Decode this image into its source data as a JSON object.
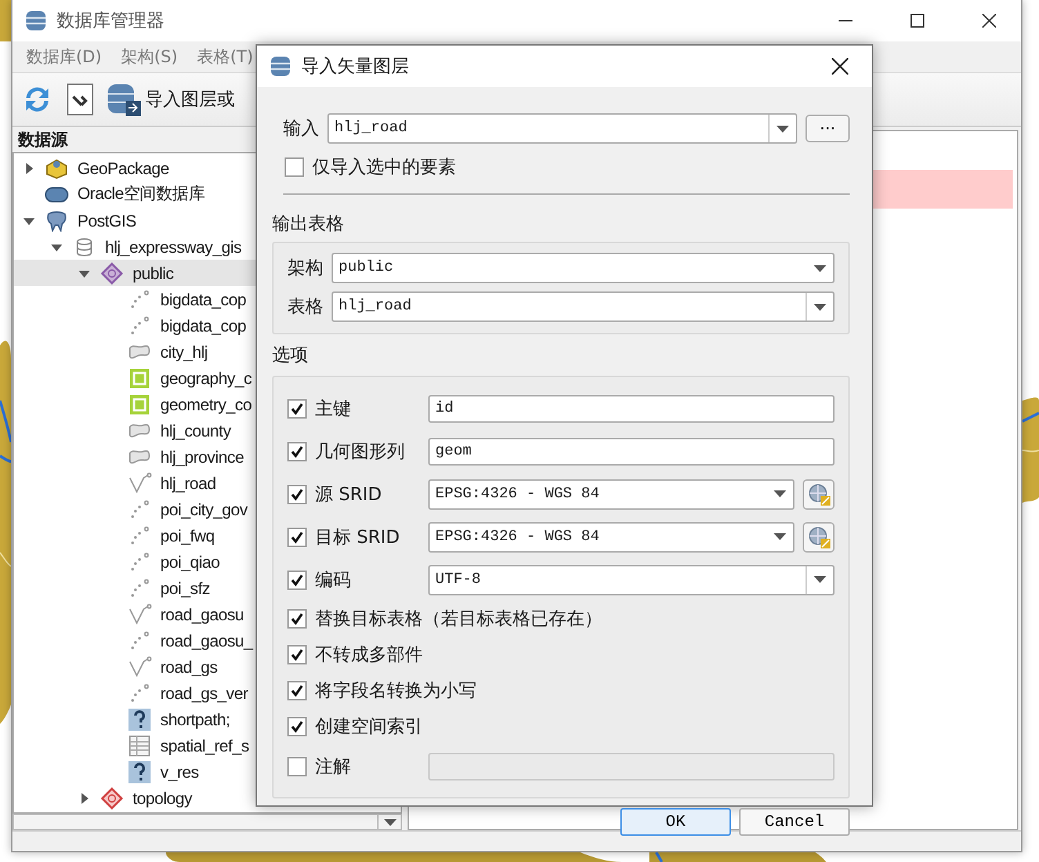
{
  "main_window": {
    "title": "数据库管理器",
    "menu": [
      "数据库(D)",
      "架构(S)",
      "表格(T)"
    ],
    "toolbar": [
      {
        "kind": "refresh"
      },
      {
        "kind": "sql"
      },
      {
        "kind": "import",
        "label": "导入图层或"
      }
    ],
    "pane_title": "数据源",
    "tree": [
      {
        "label": "GeoPackage",
        "kind": "geopackage",
        "expanded": false
      },
      {
        "label": "Oracle空间数据库",
        "kind": "oracle"
      },
      {
        "label": "PostGIS",
        "kind": "postgis",
        "expanded": true,
        "children": [
          {
            "label": "hlj_expressway_gis",
            "kind": "database",
            "expanded": true,
            "children": [
              {
                "label": "public",
                "kind": "schema",
                "expanded": true,
                "selected": true,
                "children": [
                  {
                    "label": "bigdata_cop",
                    "kind": "point"
                  },
                  {
                    "label": "bigdata_cop",
                    "kind": "point"
                  },
                  {
                    "label": "city_hlj",
                    "kind": "polygon"
                  },
                  {
                    "label": "geography_c",
                    "kind": "collection"
                  },
                  {
                    "label": "geometry_co",
                    "kind": "collection"
                  },
                  {
                    "label": "hlj_county",
                    "kind": "polygon"
                  },
                  {
                    "label": "hlj_province",
                    "kind": "polygon"
                  },
                  {
                    "label": "hlj_road",
                    "kind": "line"
                  },
                  {
                    "label": "poi_city_gov",
                    "kind": "point"
                  },
                  {
                    "label": "poi_fwq",
                    "kind": "point"
                  },
                  {
                    "label": "poi_qiao",
                    "kind": "point"
                  },
                  {
                    "label": "poi_sfz",
                    "kind": "point"
                  },
                  {
                    "label": "road_gaosu",
                    "kind": "line"
                  },
                  {
                    "label": "road_gaosu_",
                    "kind": "point"
                  },
                  {
                    "label": "road_gs",
                    "kind": "line"
                  },
                  {
                    "label": "road_gs_ver",
                    "kind": "point"
                  },
                  {
                    "label": "shortpath;",
                    "kind": "unknown"
                  },
                  {
                    "label": "spatial_ref_s",
                    "kind": "table"
                  },
                  {
                    "label": "v_res",
                    "kind": "unknown"
                  }
                ]
              },
              {
                "label": "topology",
                "kind": "schema-red",
                "expanded": false,
                "selected": false
              }
            ]
          }
        ]
      }
    ]
  },
  "dialog": {
    "title": "导入矢量图层",
    "input": {
      "label": "输入",
      "value": "hlj_road"
    },
    "browse_button": "···",
    "selected_only": {
      "label": "仅导入选中的要素",
      "checked": false
    },
    "output": {
      "title": "输出表格",
      "schema": {
        "label": "架构",
        "value": "public"
      },
      "table": {
        "label": "表格",
        "value": "hlj_road"
      }
    },
    "options": {
      "title": "选项",
      "rows": [
        {
          "kind": "text",
          "label": "主键",
          "checked": true,
          "value": "id"
        },
        {
          "kind": "text",
          "label": "几何图形列",
          "checked": true,
          "value": "geom"
        },
        {
          "kind": "crs",
          "label": "源 SRID",
          "checked": true,
          "value": "EPSG:4326 - WGS 84"
        },
        {
          "kind": "crs",
          "label": "目标 SRID",
          "checked": true,
          "value": "EPSG:4326 - WGS 84"
        },
        {
          "kind": "combo",
          "label": "编码",
          "checked": true,
          "value": "UTF-8"
        },
        {
          "kind": "check",
          "label": "替换目标表格（若目标表格已存在）",
          "checked": true
        },
        {
          "kind": "check",
          "label": "不转成多部件",
          "checked": true
        },
        {
          "kind": "check",
          "label": "将字段名转换为小写",
          "checked": true
        },
        {
          "kind": "check",
          "label": "创建空间索引",
          "checked": true
        },
        {
          "kind": "note",
          "label": "注解",
          "checked": false
        }
      ]
    },
    "buttons": [
      {
        "label": "OK",
        "default": true
      },
      {
        "label": "Cancel",
        "default": false
      }
    ]
  }
}
